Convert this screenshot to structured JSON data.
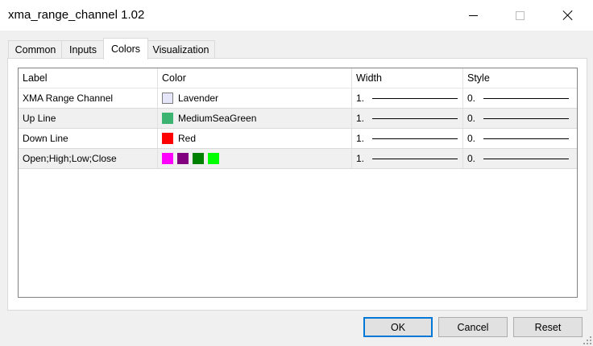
{
  "window": {
    "title": "xma_range_channel 1.02"
  },
  "tabs": [
    {
      "label": "Common"
    },
    {
      "label": "Inputs"
    },
    {
      "label": "Colors",
      "active": true
    },
    {
      "label": "Visualization"
    }
  ],
  "table": {
    "columns": [
      "Label",
      "Color",
      "Width",
      "Style"
    ],
    "rows": [
      {
        "label": "XMA Range Channel",
        "color_name": "Lavender",
        "swatch": "#e6e6fa",
        "width": "1.",
        "style": "0."
      },
      {
        "label": "Up Line",
        "color_name": "MediumSeaGreen",
        "swatch": "#3cb371",
        "width": "1.",
        "style": "0."
      },
      {
        "label": "Down Line",
        "color_name": "Red",
        "swatch": "#ff0000",
        "width": "1.",
        "style": "0."
      },
      {
        "label": "Open;High;Low;Close",
        "color_name": "",
        "swatches": [
          "#ff00ff",
          "#800080",
          "#008000",
          "#00ff00"
        ],
        "width": "1.",
        "style": "0."
      }
    ]
  },
  "buttons": {
    "ok": "OK",
    "cancel": "Cancel",
    "reset": "Reset"
  },
  "colors": {
    "accent": "#0078d7",
    "alt_row": "#f0f0f0"
  }
}
